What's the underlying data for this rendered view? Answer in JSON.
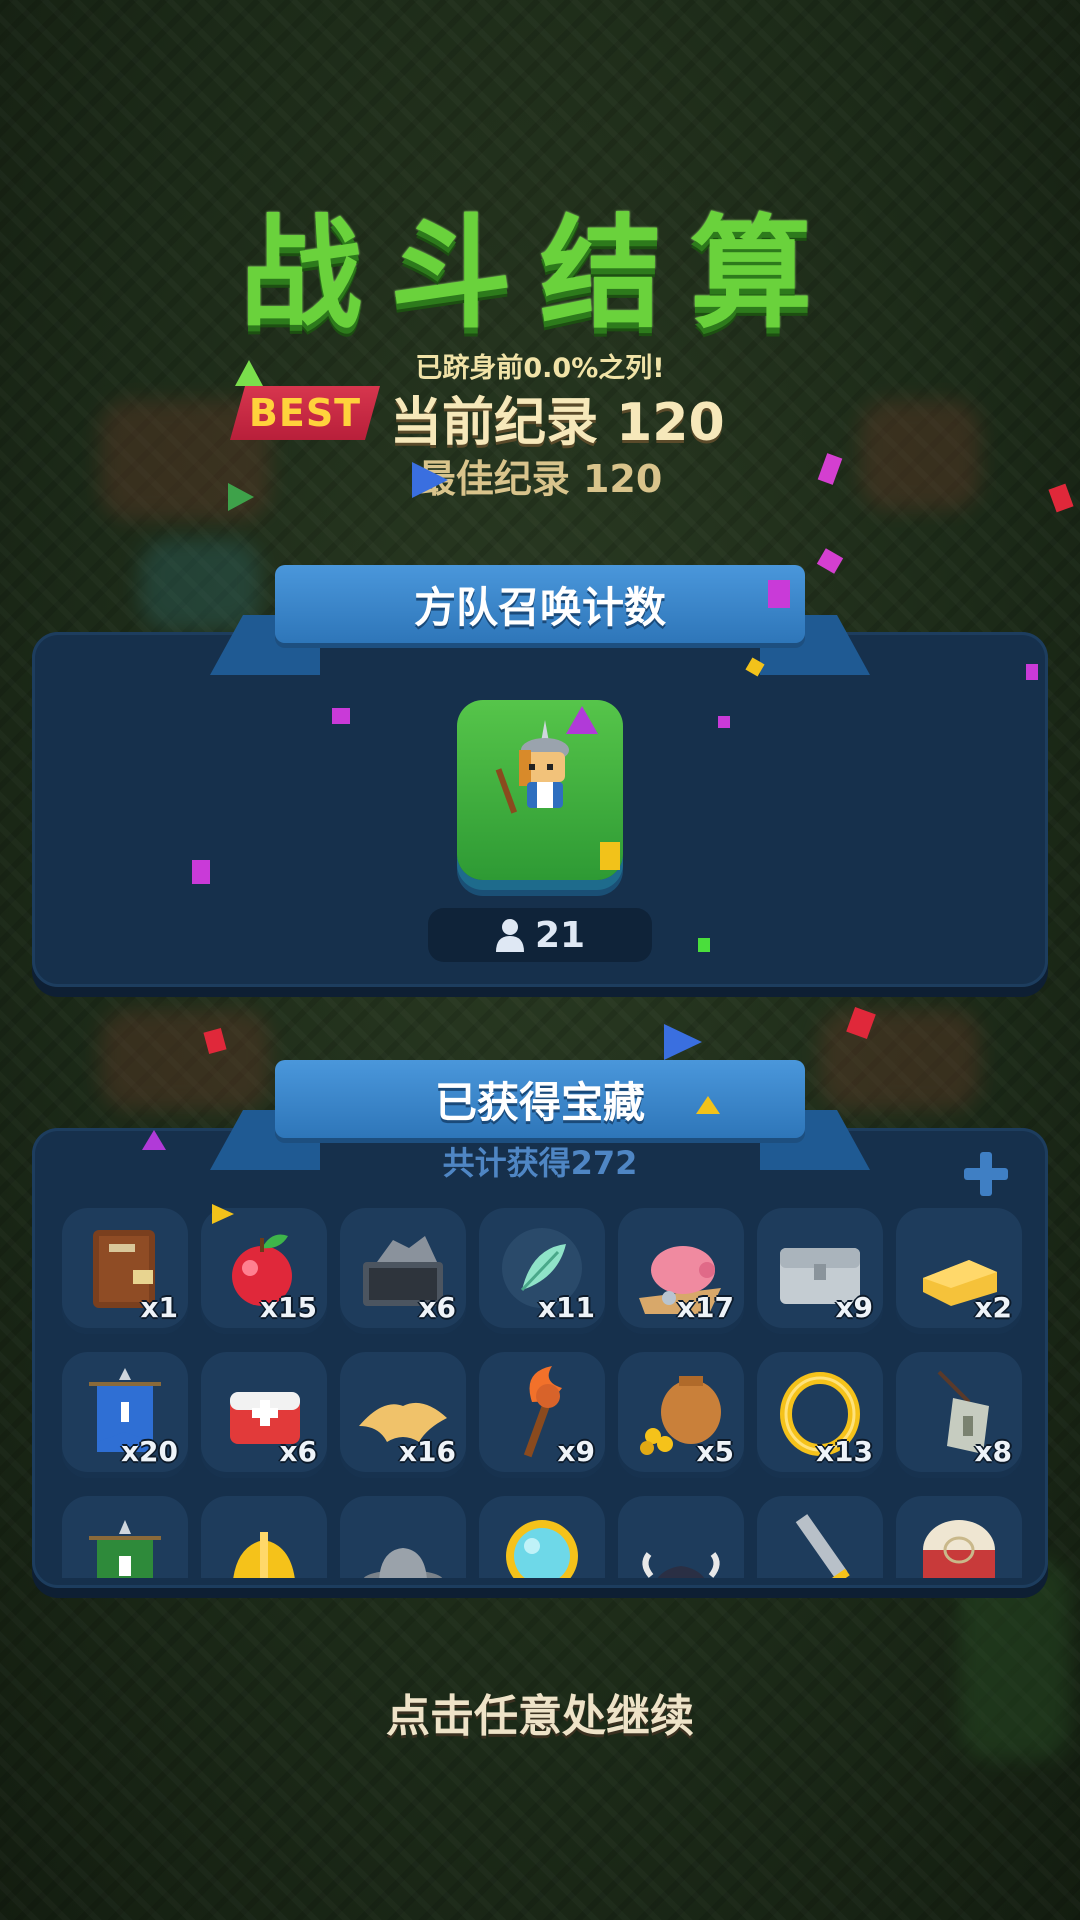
{
  "header": {
    "title": "战斗结算",
    "rank_note": "已跻身前0.0%之列!",
    "best_badge": "BEST",
    "current_record": "当前纪录 120",
    "best_record": "最佳纪录 120"
  },
  "squad_panel": {
    "ribbon_title": "方队召唤计数",
    "unit_icon": "knight-on-grass-tile",
    "count": "21",
    "count_icon": "person-icon"
  },
  "treasure_panel": {
    "ribbon_title": "已获得宝藏",
    "total": "共计获得272",
    "items": [
      {
        "icon": "book",
        "qty": "x1"
      },
      {
        "icon": "apple",
        "qty": "x15"
      },
      {
        "icon": "ore-cart",
        "qty": "x6"
      },
      {
        "icon": "feather",
        "qty": "x11"
      },
      {
        "icon": "piggy-bank",
        "qty": "x17"
      },
      {
        "icon": "iron-chest",
        "qty": "x9"
      },
      {
        "icon": "cheese",
        "qty": "x2"
      },
      {
        "icon": "blue-banner",
        "qty": "x20"
      },
      {
        "icon": "medkit",
        "qty": "x6"
      },
      {
        "icon": "pelt",
        "qty": "x16"
      },
      {
        "icon": "fire-staff",
        "qty": "x9"
      },
      {
        "icon": "pot-of-gold",
        "qty": "x5"
      },
      {
        "icon": "gold-ring",
        "qty": "x13"
      },
      {
        "icon": "pendant",
        "qty": "x8"
      },
      {
        "icon": "green-banner",
        "qty": ""
      },
      {
        "icon": "golden-helmet",
        "qty": ""
      },
      {
        "icon": "grey-hat",
        "qty": ""
      },
      {
        "icon": "mirror",
        "qty": ""
      },
      {
        "icon": "horned-helmet",
        "qty": ""
      },
      {
        "icon": "sword",
        "qty": ""
      },
      {
        "icon": "drum",
        "qty": ""
      }
    ]
  },
  "footer": {
    "continue_hint": "点击任意处继续"
  },
  "colors": {
    "title_green": "#6ad23c",
    "panel_blue": "#16304c",
    "ribbon_blue": "#3a86c9",
    "best_red": "#c92a44"
  }
}
